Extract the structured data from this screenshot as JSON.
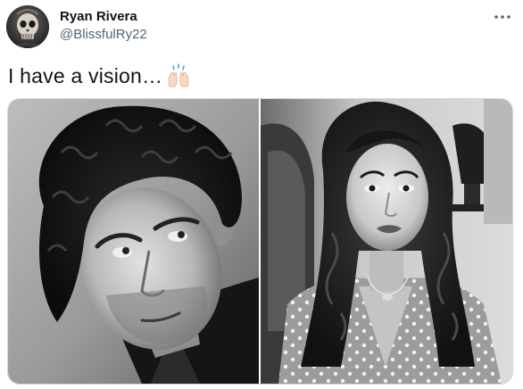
{
  "tweet": {
    "author": {
      "display_name": "Ryan Rivera",
      "handle": "@BlissfulRy22",
      "avatar_icon": "skull-avatar-icon"
    },
    "more_icon": "more-horizontal-icon",
    "text": "I have a vision…",
    "text_emoji": "raising-hands-emoji",
    "media": {
      "photos": [
        {
          "description_icon": "photo-man-curly-hair"
        },
        {
          "description_icon": "photo-woman-long-hair"
        }
      ],
      "border_color": "#cfd9de"
    }
  },
  "colors": {
    "text_primary": "#0f1419",
    "text_secondary": "#536471",
    "background": "#ffffff"
  }
}
